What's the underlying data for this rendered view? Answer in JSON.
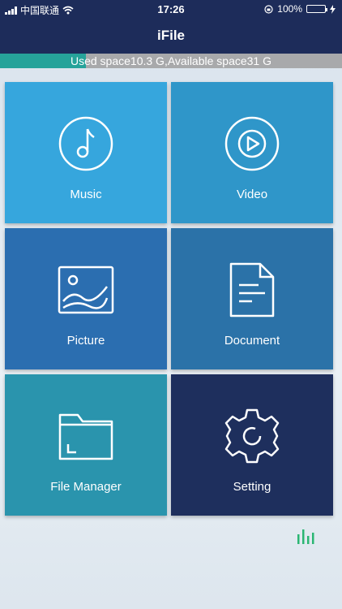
{
  "status": {
    "carrier": "中国联通",
    "time": "17:26",
    "battery": "100%"
  },
  "header": {
    "title": "iFile"
  },
  "storage": {
    "text": "Used space10.3 G,Available space31 G",
    "used_fraction": 0.25,
    "used_color": "#26a39a",
    "free_color": "#a8a9ab"
  },
  "tiles": [
    {
      "label": "Music",
      "icon": "music-icon",
      "color": "#36a6dd"
    },
    {
      "label": "Video",
      "icon": "play-icon",
      "color": "#2f96c9"
    },
    {
      "label": "Picture",
      "icon": "image-icon",
      "color": "#2b6eb0"
    },
    {
      "label": "Document",
      "icon": "document-icon",
      "color": "#2b72a8"
    },
    {
      "label": "File Manager",
      "icon": "folder-icon",
      "color": "#2a94ad"
    },
    {
      "label": "Setting",
      "icon": "gear-icon",
      "color": "#1e2f5d"
    }
  ],
  "footer": {
    "icon": "equalizer-icon",
    "color": "#2bb673"
  }
}
